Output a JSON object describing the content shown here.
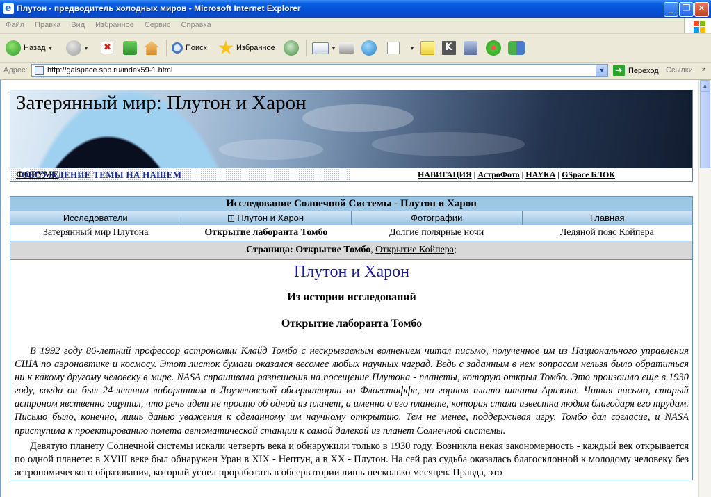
{
  "window": {
    "title": "Плутон - предводитель холодных миров - Microsoft Internet Explorer",
    "minimize_glyph": "_",
    "maximize_glyph": "❐",
    "close_glyph": "✕"
  },
  "menu": [
    "Файл",
    "Правка",
    "Вид",
    "Избранное",
    "Сервис",
    "Справка"
  ],
  "toolbar": {
    "back_label": "Назад",
    "search_label": "Поиск",
    "favorites_label": "Избранное",
    "icons": [
      "back-icon",
      "forward-icon",
      "stop-icon",
      "refresh-icon",
      "home-icon",
      "search-icon",
      "favorites-icon",
      "history-icon",
      "mail-icon",
      "print-icon",
      "messenger-icon",
      "word-icon",
      "notes-icon",
      "k-icon",
      "research-icon",
      "icq-icon",
      "users-icon"
    ]
  },
  "address": {
    "label": "Адрес:",
    "url": "http://galspace.spb.ru/index59-1.html",
    "go_label": "Переход",
    "links_label": "Ссылки",
    "links_arrow": "»"
  },
  "page": {
    "banner_title": "Затерянный мир: Плутон и Харон",
    "forum_text": "ОБСУЖДЕНИЕ ТЕМЫ НА НАШЕМ",
    "forum_link": "ФОРУМЕ",
    "nav_links": [
      "НАВИГАЦИЯ",
      "АстроФото",
      "НАУКА",
      "GSpace БЛОК"
    ],
    "nav_separator": " | ",
    "section_title": "Исследование Солнечной Системы - Плутон и Харон",
    "tabs": [
      {
        "label": "Исследователи",
        "active": false
      },
      {
        "label": "Плутон и Харон",
        "active": true
      },
      {
        "label": "Фотографии",
        "active": false
      },
      {
        "label": "Главная",
        "active": false
      }
    ],
    "tab_plus": "+",
    "subnav": [
      {
        "label": "Затерянный мир Плутона",
        "active": false
      },
      {
        "label": "Открытие лаборанта Томбо",
        "active": true
      },
      {
        "label": "Долгие полярные ночи",
        "active": false
      },
      {
        "label": "Ледяной пояс Койпера",
        "active": false
      }
    ],
    "pagebar": {
      "prefix": "Страница:",
      "current": "Открытие Томбо",
      "comma": ",",
      "link": "Открытие Койпера",
      "suffix": ";"
    },
    "article": {
      "heading": "Плутон и Харон",
      "subheading": "Из истории исследований",
      "section_heading": "Открытие лаборанта Томбо",
      "italic_paragraph": "В 1992 году 86-летний профессор астрономии Клайд Томбо с нескрываемым волнением читал письмо, полученное им из Национального управления США по аэронавтике и космосу. Этот листок бумаги оказался весомее любых научных наград. Ведь с заданным в нем вопросом нельзя было обратиться ни к какому другому человеку в мире. NASA спрашивала разрешения на посещение Плутона - планеты, которую открыл Томбо. Это произошло еще в 1930 году, когда он был 24-летним лаборантом в Лоуэлловской обсерватории во Флагстаффе, на горном плато штата Аризона. Читая письмо, старый астроном явственно ощутил, что речь идет не просто об одной из планет, а именно о его планете, которая стала известна людям благодаря его трудам. Письмо было, конечно, лишь данью уважения к сделанному им научному открытию. Тем не менее, поддерживая игру, Томбо дал согласие, и NASA приступила к проектированию полета автоматической станции к самой далекой из планет Солнечной системы.",
      "paragraph_2": "Девятую планету Солнечной системы искали четверть века и обнаружили только в 1930 году. Возникла некая закономерность - каждый век открывается по одной планете: в XVIII веке был обнаружен Уран в XIX - Нептун, а в XX - Плутон. На сей раз судьба оказалась благосклонной к молодому человеку без астрономического образования, который успел проработать в обсерватории лишь несколько месяцев. Правда, это"
    }
  }
}
